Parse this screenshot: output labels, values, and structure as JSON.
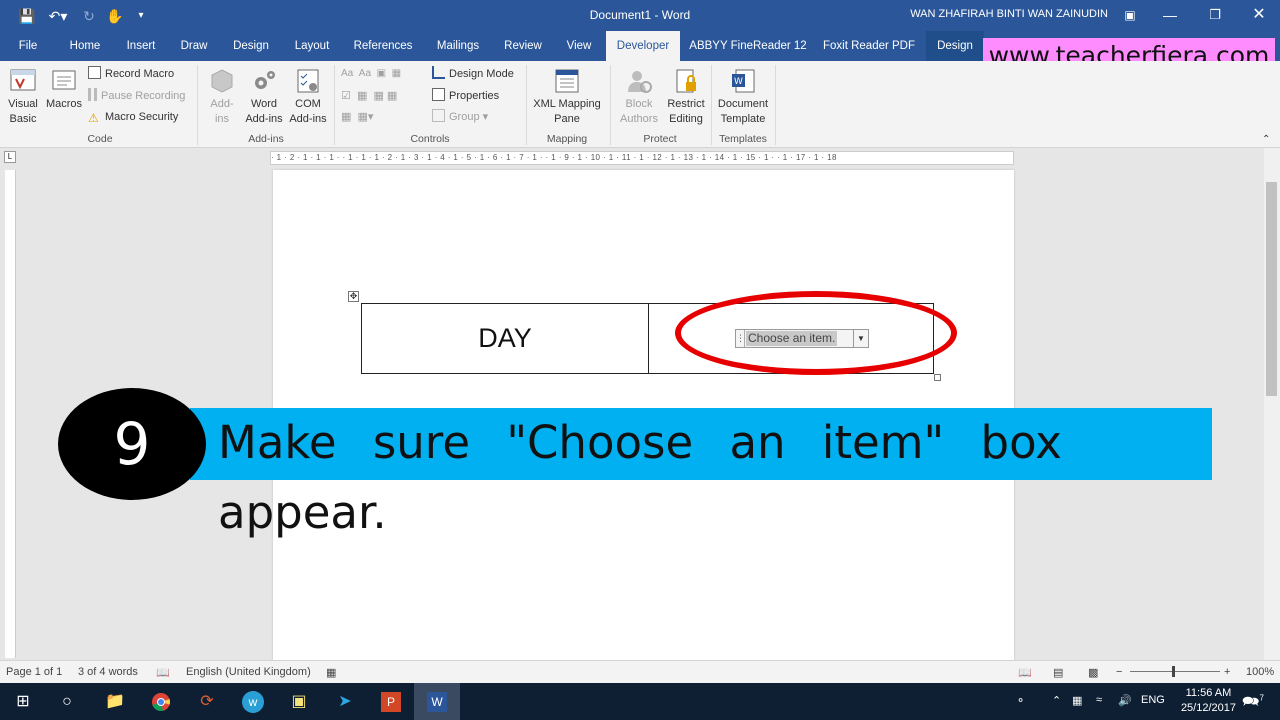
{
  "window": {
    "doc_title": "Document1  -  Word",
    "user_name": "WAN ZHAFIRAH BINTI WAN ZAINUDIN"
  },
  "tabs": [
    "File",
    "Home",
    "Insert",
    "Draw",
    "Design",
    "Layout",
    "References",
    "Mailings",
    "Review",
    "View",
    "Developer",
    "ABBYY FineReader 12",
    "Foxit Reader PDF",
    "Design"
  ],
  "active_tab": "Developer",
  "watermark": "www.teacherfiera.com",
  "ribbon": {
    "code": {
      "label": "Code",
      "visual_basic": [
        "Visual",
        "Basic"
      ],
      "macros": "Macros",
      "record_macro": "Record Macro",
      "pause_recording": "Pause Recording",
      "macro_security": "Macro Security"
    },
    "addins": {
      "label": "Add-ins",
      "addins": [
        "Add-",
        "ins"
      ],
      "word_addins": [
        "Word",
        "Add-ins"
      ],
      "com_addins": [
        "COM",
        "Add-ins"
      ]
    },
    "controls": {
      "label": "Controls",
      "design_mode": "Design Mode",
      "properties": "Properties",
      "group": "Group"
    },
    "mapping": {
      "label": "Mapping",
      "xml_pane": [
        "XML Mapping",
        "Pane"
      ]
    },
    "protect": {
      "label": "Protect",
      "block_authors": [
        "Block",
        "Authors"
      ],
      "restrict_editing": [
        "Restrict",
        "Editing"
      ]
    },
    "templates": {
      "label": "Templates",
      "document_template": [
        "Document",
        "Template"
      ]
    }
  },
  "ruler": "· 1 · 2 · 1 · 1 · 1 ·   · 1 · 1 · 1 · 2 · 1 · 3 · 1 · 4 · 1 · 5 · 1 · 6 · 1 · 7 · 1 ·   · 1 · 9 · 1 · 10 · 1 · 11 · 1 · 12 · 1 · 13 · 1 · 14 · 1 · 15 · 1 ·   · 1 · 17 · 1 · 18",
  "document": {
    "cell_day": "DAY",
    "content_control": "Choose an item."
  },
  "banner": {
    "step": "9",
    "text": "Make sure \"Choose an item\" box appear."
  },
  "status": {
    "page": "Page 1 of 1",
    "words": "3 of 4 words",
    "language": "English (United Kingdom)",
    "zoom": "100%",
    "zoom_plus": "+",
    "zoom_minus": "−"
  },
  "taskbar": {
    "lang": "ENG",
    "time": "11:56 AM",
    "date": "25/12/2017",
    "notif_count": "7"
  },
  "colors": {
    "word_blue": "#2b579a",
    "banner": "#00b0f0",
    "watermark_bg": "#ff8cff",
    "highlight": "#e60000"
  }
}
